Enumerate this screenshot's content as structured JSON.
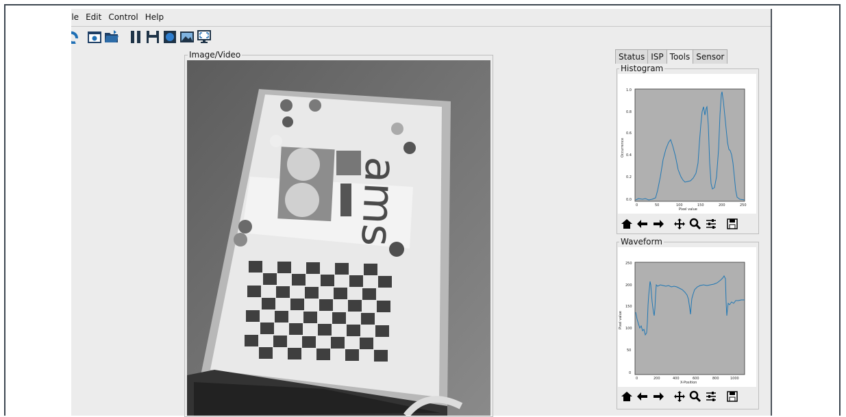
{
  "menu": {
    "file": "ile",
    "edit": "Edit",
    "control": "Control",
    "help": "Help"
  },
  "toolbar": {
    "icons": [
      "refresh-icon",
      "settings-window-icon",
      "open-folder-icon",
      "pause-icon",
      "save-icon",
      "record-icon",
      "snapshot-icon",
      "fullscreen-icon"
    ]
  },
  "video_group": {
    "title": "Image/Video"
  },
  "tabs": [
    {
      "label": "Status"
    },
    {
      "label": "ISP"
    },
    {
      "label": "Tools"
    },
    {
      "label": "Sensor"
    }
  ],
  "histogram": {
    "title": "Histogram",
    "xlabel": "Pixel value",
    "ylabel": "Occurrence",
    "xticks": [
      "0",
      "50",
      "100",
      "150",
      "200",
      "250"
    ],
    "yticks": [
      "0.0",
      "0.2",
      "0.4",
      "0.6",
      "0.8",
      "1.0"
    ]
  },
  "waveform": {
    "title": "Waveform",
    "xlabel": "X-Position",
    "ylabel": "Pixel value",
    "xticks": [
      "0",
      "200",
      "400",
      "600",
      "800",
      "1000"
    ],
    "yticks": [
      "0",
      "50",
      "100",
      "150",
      "200",
      "250"
    ]
  },
  "colors": {
    "plot_bg": "#b0b0b0",
    "line": "#1f77b4"
  }
}
